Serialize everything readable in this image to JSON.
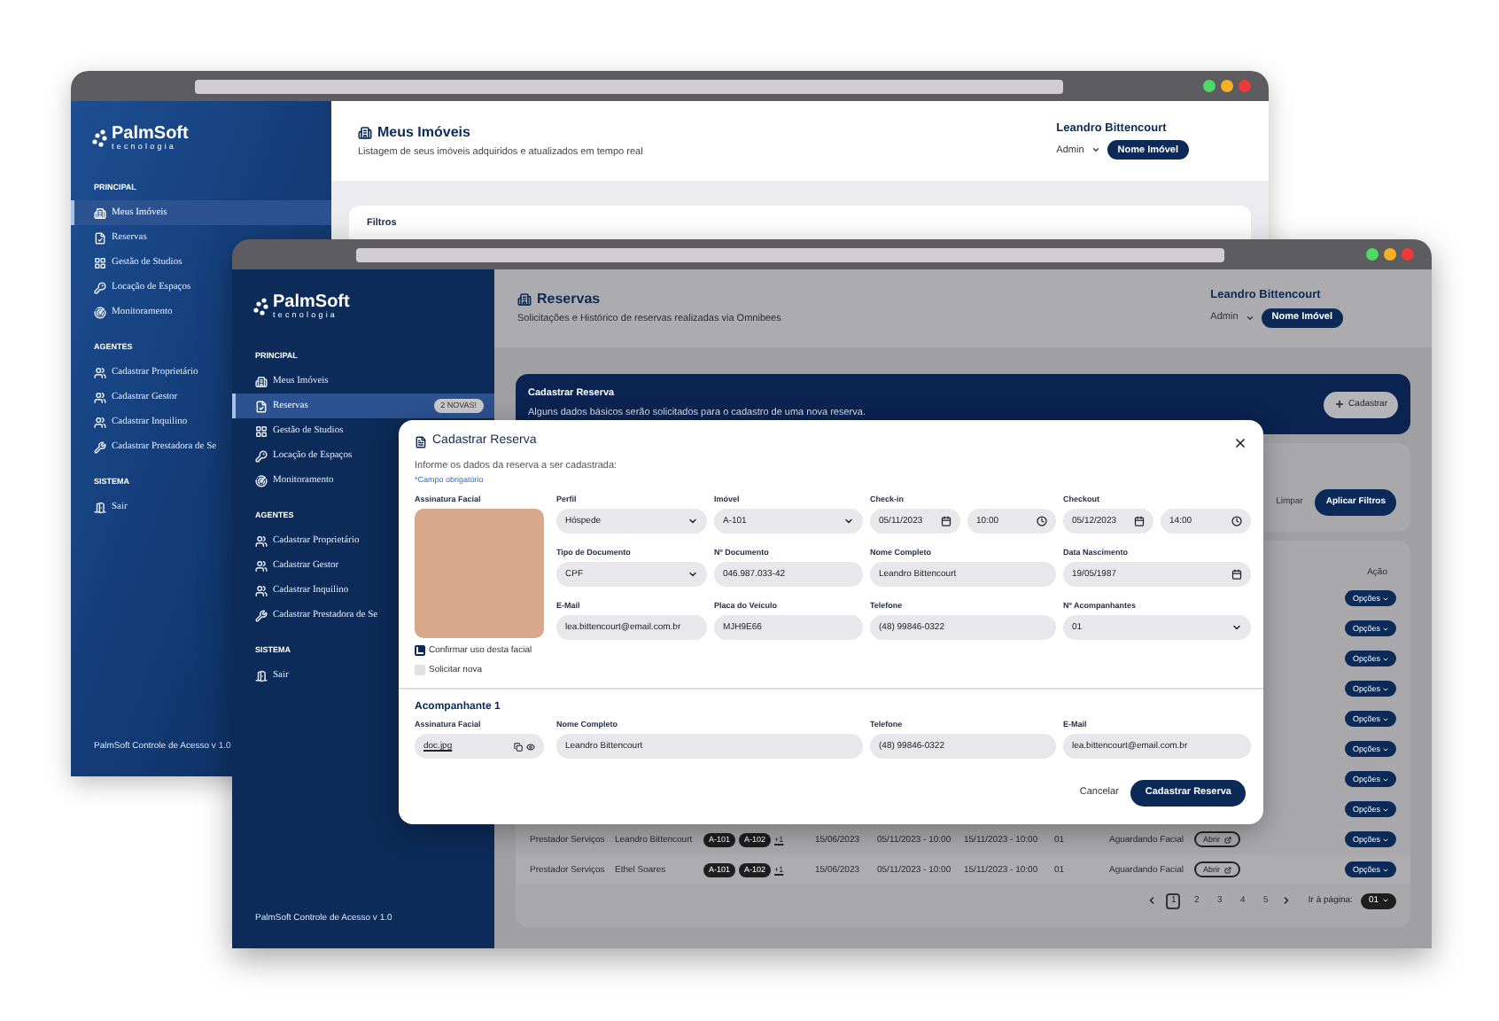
{
  "back_window": {
    "sidebar": {
      "logo": {
        "name": "PalmSoft",
        "tagline": "tecnologia"
      },
      "sections": [
        {
          "title": "PRINCIPAL",
          "items": [
            {
              "label": "Meus Imóveis",
              "selected": true
            },
            {
              "label": "Reservas",
              "selected": false
            },
            {
              "label": "Gestão de Studios",
              "selected": false
            },
            {
              "label": "Locação de Espaços",
              "selected": false
            },
            {
              "label": "Monitoramento",
              "selected": false
            }
          ]
        },
        {
          "title": "AGENTES",
          "items": [
            {
              "label": "Cadastrar Proprietário",
              "selected": false
            },
            {
              "label": "Cadastrar Gestor",
              "selected": false
            },
            {
              "label": "Cadastrar Inquilino",
              "selected": false
            },
            {
              "label": "Cadastrar Prestadora de Se",
              "selected": false
            }
          ]
        },
        {
          "title": "SISTEMA",
          "items": [
            {
              "label": "Sair",
              "selected": false
            }
          ]
        }
      ],
      "footer": "PalmSoft Controle de Acesso v 1.0"
    },
    "header": {
      "title": "Meus Imóveis",
      "subtitle": "Listagem de seus imóveis adquiridos e atualizados em tempo real",
      "user": "Leandro Bittencourt",
      "role": "Admin",
      "property_button": "Nome Imóvel"
    },
    "filters": {
      "title": "Filtros"
    }
  },
  "front_window": {
    "sidebar": {
      "logo": {
        "name": "PalmSoft",
        "tagline": "tecnologia"
      },
      "sections": [
        {
          "title": "PRINCIPAL",
          "items": [
            {
              "label": "Meus Imóveis",
              "selected": false
            },
            {
              "label": "Reservas",
              "selected": true,
              "badge": "2 NOVAS!"
            },
            {
              "label": "Gestão de Studios",
              "selected": false
            },
            {
              "label": "Locação de Espaços",
              "selected": false
            },
            {
              "label": "Monitoramento",
              "selected": false
            }
          ]
        },
        {
          "title": "AGENTES",
          "items": [
            {
              "label": "Cadastrar Proprietário",
              "selected": false
            },
            {
              "label": "Cadastrar Gestor",
              "selected": false
            },
            {
              "label": "Cadastrar Inquilino",
              "selected": false
            },
            {
              "label": "Cadastrar Prestadora de Se",
              "selected": false
            }
          ]
        },
        {
          "title": "SISTEMA",
          "items": [
            {
              "label": "Sair",
              "selected": false
            }
          ]
        }
      ],
      "footer": "PalmSoft Controle de Acesso v 1.0"
    },
    "header": {
      "title": "Reservas",
      "subtitle": "Solicitações e Histórico de reservas realizadas via Omnibees",
      "user": "Leandro Bittencourt",
      "role": "Admin",
      "property_button": "Nome Imóvel"
    },
    "banner": {
      "title": "Cadastrar Reserva",
      "description": "Alguns dados básicos serão solicitados para o cadastro de uma nova reserva.",
      "button": "Cadastrar"
    },
    "filters": {
      "clear": "Limpar",
      "apply": "Aplicar Filtros"
    },
    "table": {
      "action_header": "Ação",
      "rows": [
        {
          "action": "Opções"
        },
        {
          "action": "Opções"
        },
        {
          "action": "Opções"
        },
        {
          "action": "Opções"
        },
        {
          "action": "Opções"
        },
        {
          "action": "Opções"
        },
        {
          "action": "Opções"
        },
        {
          "action": "Opções"
        },
        {
          "role": "Prestador Serviços",
          "name": "Leandro Bittencourt",
          "units": [
            "A-101",
            "A-102"
          ],
          "more": "+1",
          "date": "15/06/2023",
          "check_in": "05/11/2023 - 10:00",
          "check_out": "15/11/2023 - 10:00",
          "guests": "01",
          "status": "Aguardando Facial",
          "open": "Abrir",
          "action": "Opções"
        },
        {
          "role": "Prestador Serviços",
          "name": "Ethel Soares",
          "units": [
            "A-101",
            "A-102"
          ],
          "more": "+1",
          "date": "15/06/2023",
          "check_in": "05/11/2023 - 10:00",
          "check_out": "15/11/2023 - 10:00",
          "guests": "01",
          "status": "Aguardando Facial",
          "open": "Abrir",
          "action": "Opções"
        }
      ],
      "pagination": {
        "pages": [
          {
            "label": "1",
            "selected": true
          },
          {
            "label": "2",
            "selected": false
          },
          {
            "label": "3",
            "selected": false
          },
          {
            "label": "4",
            "selected": false
          },
          {
            "label": "5",
            "selected": false
          }
        ],
        "go_to_label": "Ir à página:",
        "go_to_value": "01"
      }
    }
  },
  "modal": {
    "title": "Cadastrar Reserva",
    "intro": "Informe os dados da reserva a ser cadastrada:",
    "required_note": "*Campo obrigatório",
    "photo_label": "Assinatura Facial",
    "checkboxes": [
      {
        "label": "Confirmar uso desta facial",
        "checked": true
      },
      {
        "label": "Solicitar nova",
        "checked": false
      }
    ],
    "fields": [
      {
        "label": "Perfil",
        "kind": "select",
        "value": "Hóspede"
      },
      {
        "label": "Imóvel",
        "kind": "select",
        "value": "A-101"
      },
      {
        "label": "Check-in",
        "kind": "datetime",
        "value": "05/11/2023",
        "time": "10:00"
      },
      {
        "label": "Checkout",
        "kind": "datetime",
        "value": "05/12/2023",
        "time": "14:00"
      },
      {
        "label": "Tipo de Documento",
        "kind": "select",
        "value": "CPF"
      },
      {
        "label": "Nº Documento",
        "kind": "text",
        "value": "046.987.033-42"
      },
      {
        "label": "Nome Completo",
        "kind": "text",
        "value": "Leandro Bittencourt"
      },
      {
        "label": "Data Nascimento",
        "kind": "date",
        "value": "19/05/1987"
      },
      {
        "label": "E-Mail",
        "kind": "text",
        "value": "lea.bittencourt@email.com.br"
      },
      {
        "label": "Placa do Veículo",
        "kind": "text",
        "value": "MJH9E66"
      },
      {
        "label": "Telefone",
        "kind": "text",
        "value": "(48) 99846-0322"
      },
      {
        "label": "Nº Acompanhantes",
        "kind": "select",
        "value": "01"
      }
    ],
    "companion": {
      "title": "Acompanhante 1",
      "signature": {
        "label": "Assinatura Facial",
        "kind": "file",
        "value": "doc.jpg"
      },
      "fields": [
        {
          "label": "Nome Completo",
          "kind": "text",
          "value": "Leandro Bittencourt"
        },
        {
          "label": "Telefone",
          "kind": "text",
          "value": "(48) 99846-0322"
        },
        {
          "label": "E-Mail",
          "kind": "text",
          "value": "lea.bittencourt@email.com.br"
        }
      ]
    },
    "buttons": {
      "cancel": "Cancelar",
      "submit": "Cadastrar Reserva"
    }
  }
}
